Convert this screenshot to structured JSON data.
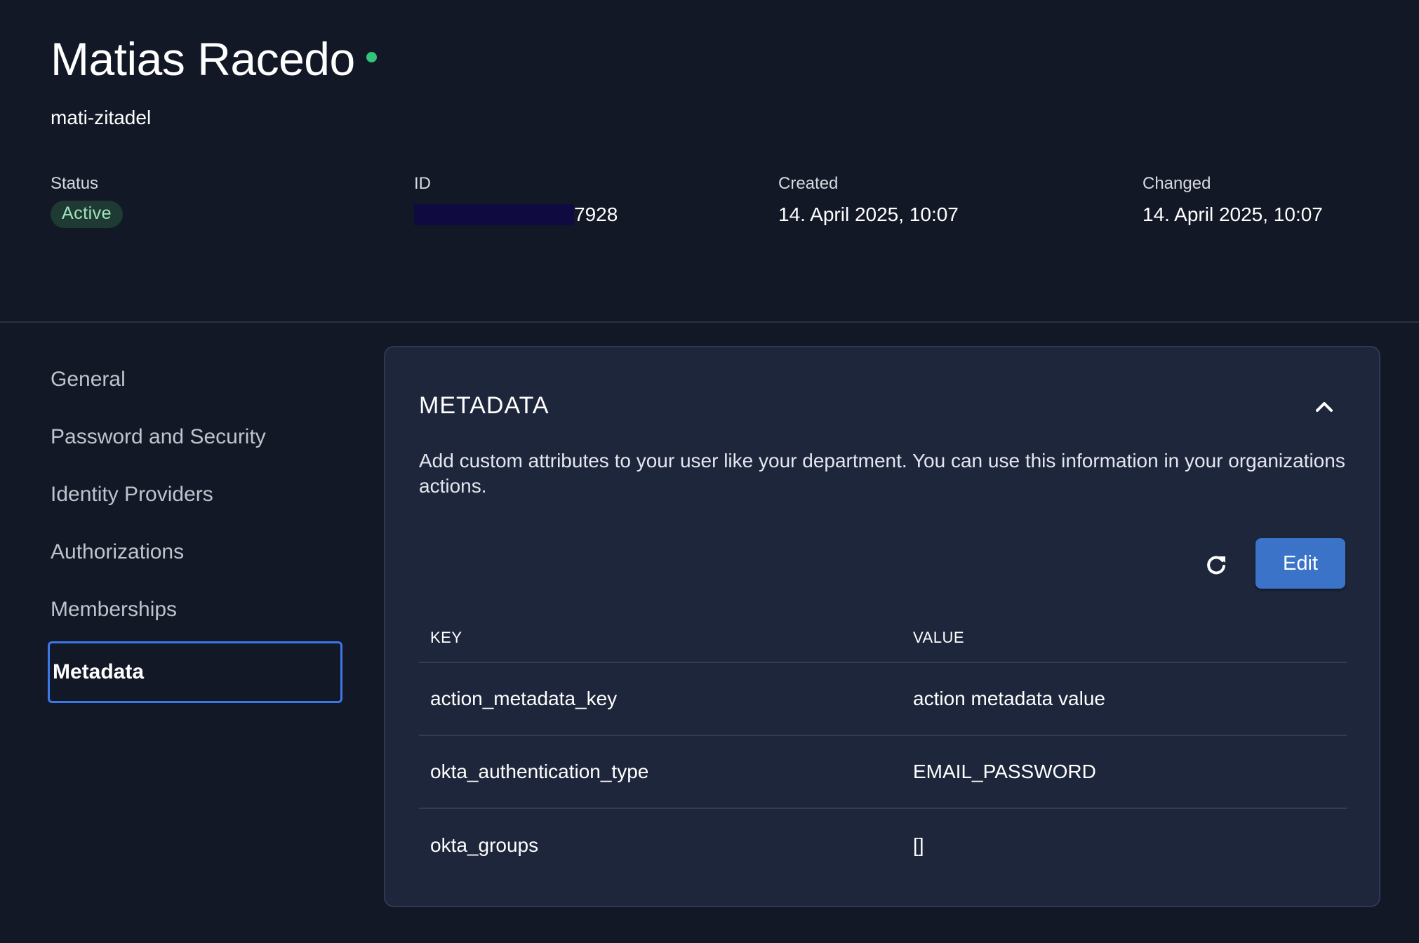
{
  "user": {
    "display_name": "Matias Racedo",
    "username": "mati-zitadel"
  },
  "info": {
    "status_label": "Status",
    "status_value": "Active",
    "id_label": "ID",
    "id_visible_suffix": "7928",
    "created_label": "Created",
    "created_value": "14. April 2025, 10:07",
    "changed_label": "Changed",
    "changed_value": "14. April 2025, 10:07"
  },
  "sidebar": {
    "items": [
      {
        "label": "General"
      },
      {
        "label": "Password and Security"
      },
      {
        "label": "Identity Providers"
      },
      {
        "label": "Authorizations"
      },
      {
        "label": "Memberships"
      },
      {
        "label": "Metadata"
      }
    ],
    "active_index": 5
  },
  "metadata_card": {
    "title": "METADATA",
    "description": "Add custom attributes to your user like your department. You can use this information in your organizations actions.",
    "edit_label": "Edit",
    "columns": {
      "key": "KEY",
      "value": "VALUE"
    },
    "rows": [
      {
        "key": "action_metadata_key",
        "value": "action metadata value"
      },
      {
        "key": "okta_authentication_type",
        "value": "EMAIL_PASSWORD"
      },
      {
        "key": "okta_groups",
        "value": "[]"
      }
    ]
  },
  "colors": {
    "background": "#121826",
    "card": "#1e263b",
    "accent": "#3a73c7",
    "online": "#33c47a"
  }
}
